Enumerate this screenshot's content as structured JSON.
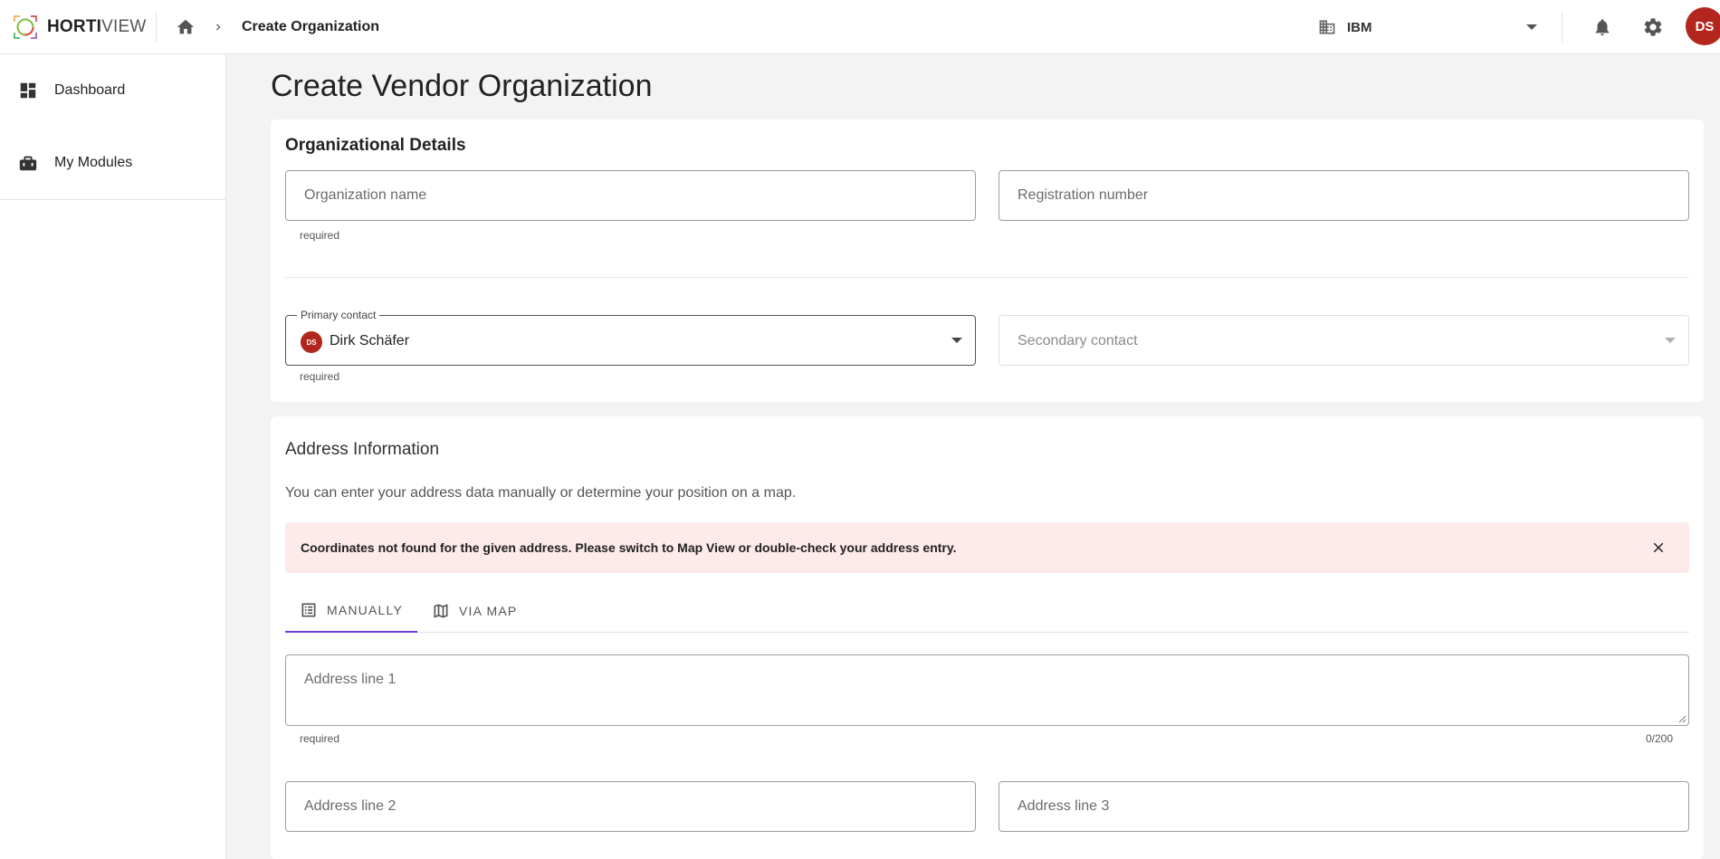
{
  "app": {
    "logo_bold": "HORTI",
    "logo_light": "VIEW"
  },
  "breadcrumb": {
    "current": "Create Organization"
  },
  "header": {
    "organization": "IBM",
    "user_initials": "DS"
  },
  "sidebar": {
    "items": [
      {
        "label": "Dashboard",
        "icon": "dashboard-icon"
      },
      {
        "label": "My Modules",
        "icon": "toolbox-icon"
      }
    ]
  },
  "page": {
    "title": "Create Vendor Organization"
  },
  "org_details": {
    "title": "Organizational Details",
    "org_name_placeholder": "Organization name",
    "org_name_value": "",
    "org_name_hint": "required",
    "registration_placeholder": "Registration number",
    "registration_value": "",
    "primary_contact_label": "Primary contact",
    "primary_contact_initials": "DS",
    "primary_contact_value": "Dirk Schäfer",
    "primary_contact_hint": "required",
    "secondary_contact_placeholder": "Secondary contact"
  },
  "address": {
    "title": "Address Information",
    "description": "You can enter your address data manually or determine your position on a map.",
    "alert": "Coordinates not found for the given address. Please switch to Map View or double-check your address entry.",
    "tabs": [
      {
        "label": "MANUALLY",
        "icon": "list-icon",
        "active": true
      },
      {
        "label": "VIA MAP",
        "icon": "map-icon",
        "active": false
      }
    ],
    "line1_placeholder": "Address line 1",
    "line1_value": "",
    "line1_hint": "required",
    "line1_counter": "0/200",
    "line2_placeholder": "Address line 2",
    "line2_value": "",
    "line3_placeholder": "Address line 3",
    "line3_value": ""
  },
  "colors": {
    "accent": "#6b3fd6",
    "avatar": "#b3261e",
    "alert_bg": "#fdeaea"
  }
}
